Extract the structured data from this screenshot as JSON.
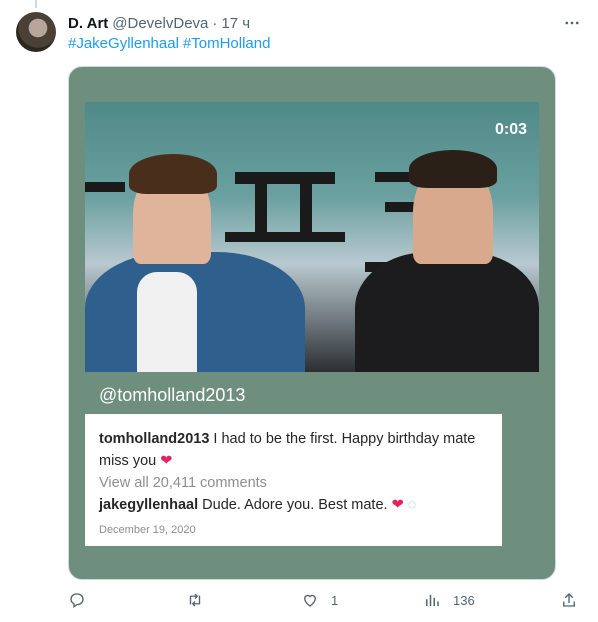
{
  "tweet": {
    "author_name": "D. Art",
    "author_handle": "@DevelvDeva",
    "dot": "·",
    "time": "17 ч",
    "hashtags": [
      "#JakeGyllenhaal",
      "#TomHolland"
    ]
  },
  "media": {
    "timestamp": "0:03",
    "instagram_handle": "@tomholland2013",
    "comment1_user": "tomholland2013",
    "comment1_text": "I had to be the first. Happy birthday mate miss you",
    "view_all": "View all 20,411 comments",
    "comment2_user": "jakegyllenhaal",
    "comment2_text": "Dude. Adore you. Best mate.",
    "date": "December 19, 2020"
  },
  "actions": {
    "likes": "1",
    "views": "136"
  },
  "colors": {
    "accent": "#1d9bf0",
    "media_bg": "#6f8f7e",
    "text_secondary": "#536471"
  }
}
